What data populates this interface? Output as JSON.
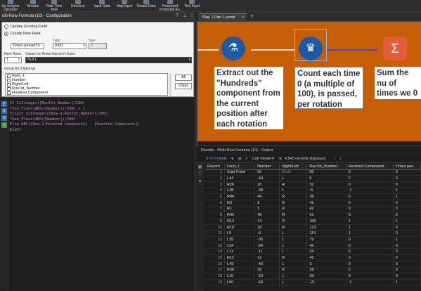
{
  "toolbar": {
    "items": [
      {
        "label": "Up Insights\nUploader",
        "icon": "upload-icon"
      },
      {
        "label": "Browse",
        "icon": "browse-icon"
      },
      {
        "label": "Date Time\nNow",
        "icon": "calendar-icon"
      },
      {
        "label": "Directory",
        "icon": "folder-icon"
      },
      {
        "label": "Input Data",
        "icon": "input-data-icon"
      },
      {
        "label": "Map Input",
        "icon": "map-icon"
      },
      {
        "label": "Output Data",
        "icon": "output-data-icon"
      },
      {
        "label": "Password\nProtected Ex...",
        "icon": "lock-icon"
      },
      {
        "label": "Text Input",
        "icon": "text-input-icon"
      }
    ]
  },
  "config": {
    "title": "ulti-Row Formula (10) - Configuration",
    "update_existing_label": "Update Existing Field",
    "create_new_label": "Create New  Field",
    "new_field_value": "Times passed 0",
    "type_label": "Type",
    "type_value": "Int32",
    "size_label": "Size",
    "size_value": "4",
    "num_rows_label": "Num Rows",
    "num_rows_value": "1",
    "values_label": "Values for Rows that don't Exist",
    "values_value": "NULL",
    "group_by_label": "Group By (Optional)",
    "group_by_items": [
      "Field_1",
      "Number",
      "Right/Left",
      "RunTot_Number",
      "Hundred Component"
    ],
    "all_button": "All",
    "clear_button": "Clear"
  },
  "expression": {
    "lines": [
      [
        {
          "t": "If IsInteger([RunTot_Number]/100)",
          "c": "kw"
        }
      ],
      [
        {
          "t": "Then Floor(ABS([Number])/100) + 1",
          "c": "kw"
        }
      ],
      [
        {
          "t": "ElseIf IsInteger([Row-1:RunTot_Number]/100)",
          "c": "kw"
        }
      ],
      [
        {
          "t": "Then Floor(ABS([Number])/100)",
          "c": "kw"
        }
      ],
      [
        {
          "t": "Else ABS([Row-1:Hundred Component] - [Hundred Component])",
          "c": "kw"
        }
      ],
      [
        {
          "t": "EndIf",
          "c": "kw"
        }
      ]
    ]
  },
  "canvas": {
    "tab_label": "*Day 1 Part 1.yxmd",
    "tools": [
      {
        "name": "formula-tool",
        "glyph": "⚗",
        "color": "#1d5aa6"
      },
      {
        "name": "multi-row-formula-tool",
        "glyph": "♛",
        "color": "#1d5aa6"
      },
      {
        "name": "summarize-tool",
        "glyph": "Σ",
        "color": "#e35d3a"
      }
    ],
    "annotations": [
      "Extract out the \"Hundreds\" component from the current position after each rotation",
      "Count each time 0 (a multiple of 100), is passed, per rotation",
      "Sum the nu of times we 0"
    ]
  },
  "results": {
    "title": "Results - Multi-Row Formula (10) - Output",
    "fields_label": "6 of 6 Fields",
    "viewer_label": "Cell Viewer",
    "records_label": "4,543 records displayed",
    "columns": [
      "Record",
      "Field_1",
      "Number",
      "Right/Left",
      "RunTot_Number",
      "Hundred Component",
      "Times pas"
    ],
    "rows": [
      [
        "1",
        "Start Point",
        "50",
        "[Null]",
        "50",
        "0",
        "0"
      ],
      [
        "2",
        "L44",
        "-44",
        "L",
        "6",
        "0",
        "0"
      ],
      [
        "3",
        "R26",
        "26",
        "R",
        "32",
        "0",
        "0"
      ],
      [
        "4",
        "L38",
        "-38",
        "L",
        "-6",
        "-1",
        "1"
      ],
      [
        "5",
        "R44",
        "44",
        "R",
        "38",
        "0",
        "1"
      ],
      [
        "6",
        "R3",
        "3",
        "R",
        "41",
        "0",
        "0"
      ],
      [
        "7",
        "R1",
        "1",
        "R",
        "42",
        "0",
        "0"
      ],
      [
        "8",
        "R49",
        "49",
        "R",
        "91",
        "0",
        "0"
      ],
      [
        "9",
        "R14",
        "14",
        "R",
        "105",
        "1",
        "1"
      ],
      [
        "10",
        "R18",
        "18",
        "R",
        "123",
        "1",
        "0"
      ],
      [
        "11",
        "L9",
        "-9",
        "L",
        "114",
        "1",
        "0"
      ],
      [
        "12",
        "L35",
        "-35",
        "L",
        "79",
        "0",
        "1"
      ],
      [
        "13",
        "L34",
        "-34",
        "L",
        "45",
        "0",
        "0"
      ],
      [
        "14",
        "L11",
        "-11",
        "L",
        "34",
        "0",
        "0"
      ],
      [
        "15",
        "R12",
        "12",
        "R",
        "46",
        "0",
        "0"
      ],
      [
        "16",
        "L43",
        "-43",
        "L",
        "3",
        "0",
        "0"
      ],
      [
        "17",
        "R36",
        "36",
        "R",
        "39",
        "0",
        "0"
      ],
      [
        "18",
        "L10",
        "-10",
        "L",
        "29",
        "0",
        "0"
      ],
      [
        "19",
        "L50",
        "-50",
        "L",
        "-21",
        "-1",
        "1"
      ]
    ]
  }
}
